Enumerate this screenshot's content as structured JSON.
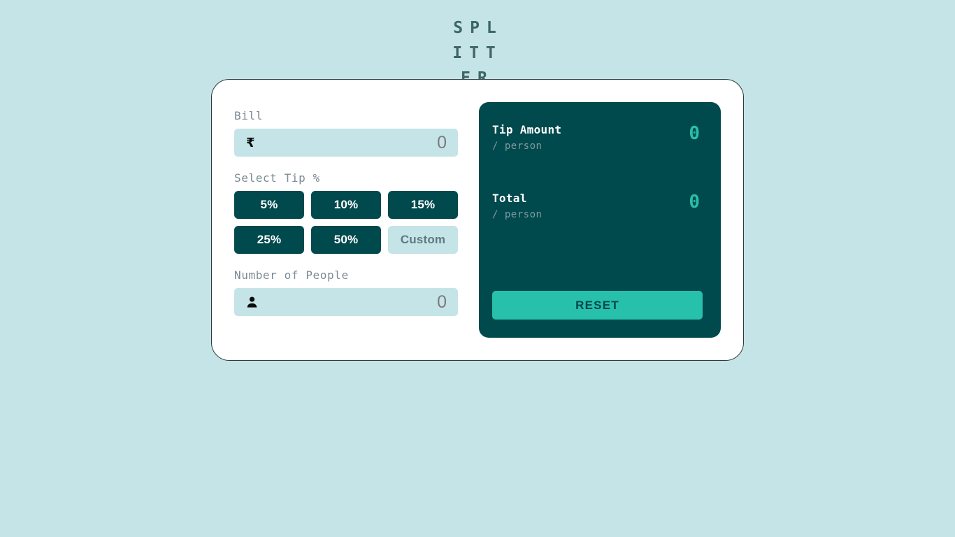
{
  "app": {
    "title": "SPLITTER"
  },
  "form": {
    "bill": {
      "label": "Bill",
      "icon": "rupee-icon",
      "value": "0",
      "placeholder": "0"
    },
    "tip": {
      "label": "Select Tip %",
      "options": [
        {
          "label": "5%",
          "selected": false
        },
        {
          "label": "10%",
          "selected": false
        },
        {
          "label": "15%",
          "selected": false
        },
        {
          "label": "25%",
          "selected": false
        },
        {
          "label": "50%",
          "selected": false
        }
      ],
      "custom": {
        "label": "Custom",
        "placeholder": "Custom"
      }
    },
    "people": {
      "label": "Number of People",
      "icon": "person-icon",
      "value": "0",
      "placeholder": "0"
    }
  },
  "results": {
    "tip_amount": {
      "title": "Tip Amount",
      "sub": "/ person",
      "value": "0"
    },
    "total": {
      "title": "Total",
      "sub": "/ person",
      "value": "0"
    },
    "reset_label": "RESET"
  },
  "colors": {
    "background": "#c5e4e7",
    "card": "#ffffff",
    "panel_dark": "#00494d",
    "accent": "#26c0ab",
    "input_bg": "#c5e4e7",
    "label_text": "#7b8b94",
    "title_text": "#3d6666"
  }
}
